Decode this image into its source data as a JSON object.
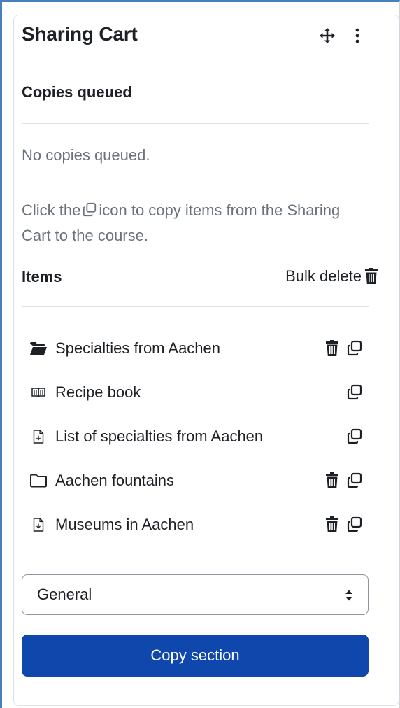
{
  "block": {
    "title": "Sharing Cart",
    "move_icon": "move-arrows-icon",
    "menu_icon": "kebab-menu-icon"
  },
  "queue": {
    "heading": "Copies queued",
    "empty_text": "No copies queued.",
    "help_before": "Click the",
    "help_after": "icon to copy items from the Sharing Cart to the course."
  },
  "items_section": {
    "heading": "Items",
    "bulk_delete_label": "Bulk delete",
    "items": [
      {
        "label": "Specialties from Aachen",
        "icon": "folder-open-icon",
        "deletable": true,
        "copyable": true
      },
      {
        "label": "Recipe book",
        "icon": "book-icon",
        "deletable": false,
        "copyable": true
      },
      {
        "label": "List of specialties from Aachen",
        "icon": "file-icon",
        "deletable": false,
        "copyable": true
      },
      {
        "label": "Aachen fountains",
        "icon": "folder-icon",
        "deletable": true,
        "copyable": true
      },
      {
        "label": "Museums in Aachen",
        "icon": "file-icon",
        "deletable": true,
        "copyable": true
      }
    ]
  },
  "section_select": {
    "selected": "General"
  },
  "copy_button": {
    "label": "Copy section"
  },
  "colors": {
    "primary": "#0f47ad",
    "text": "#1d2125",
    "muted": "#6a737b",
    "border": "#dee2e6",
    "frame_accent": "#4a7fbf"
  }
}
